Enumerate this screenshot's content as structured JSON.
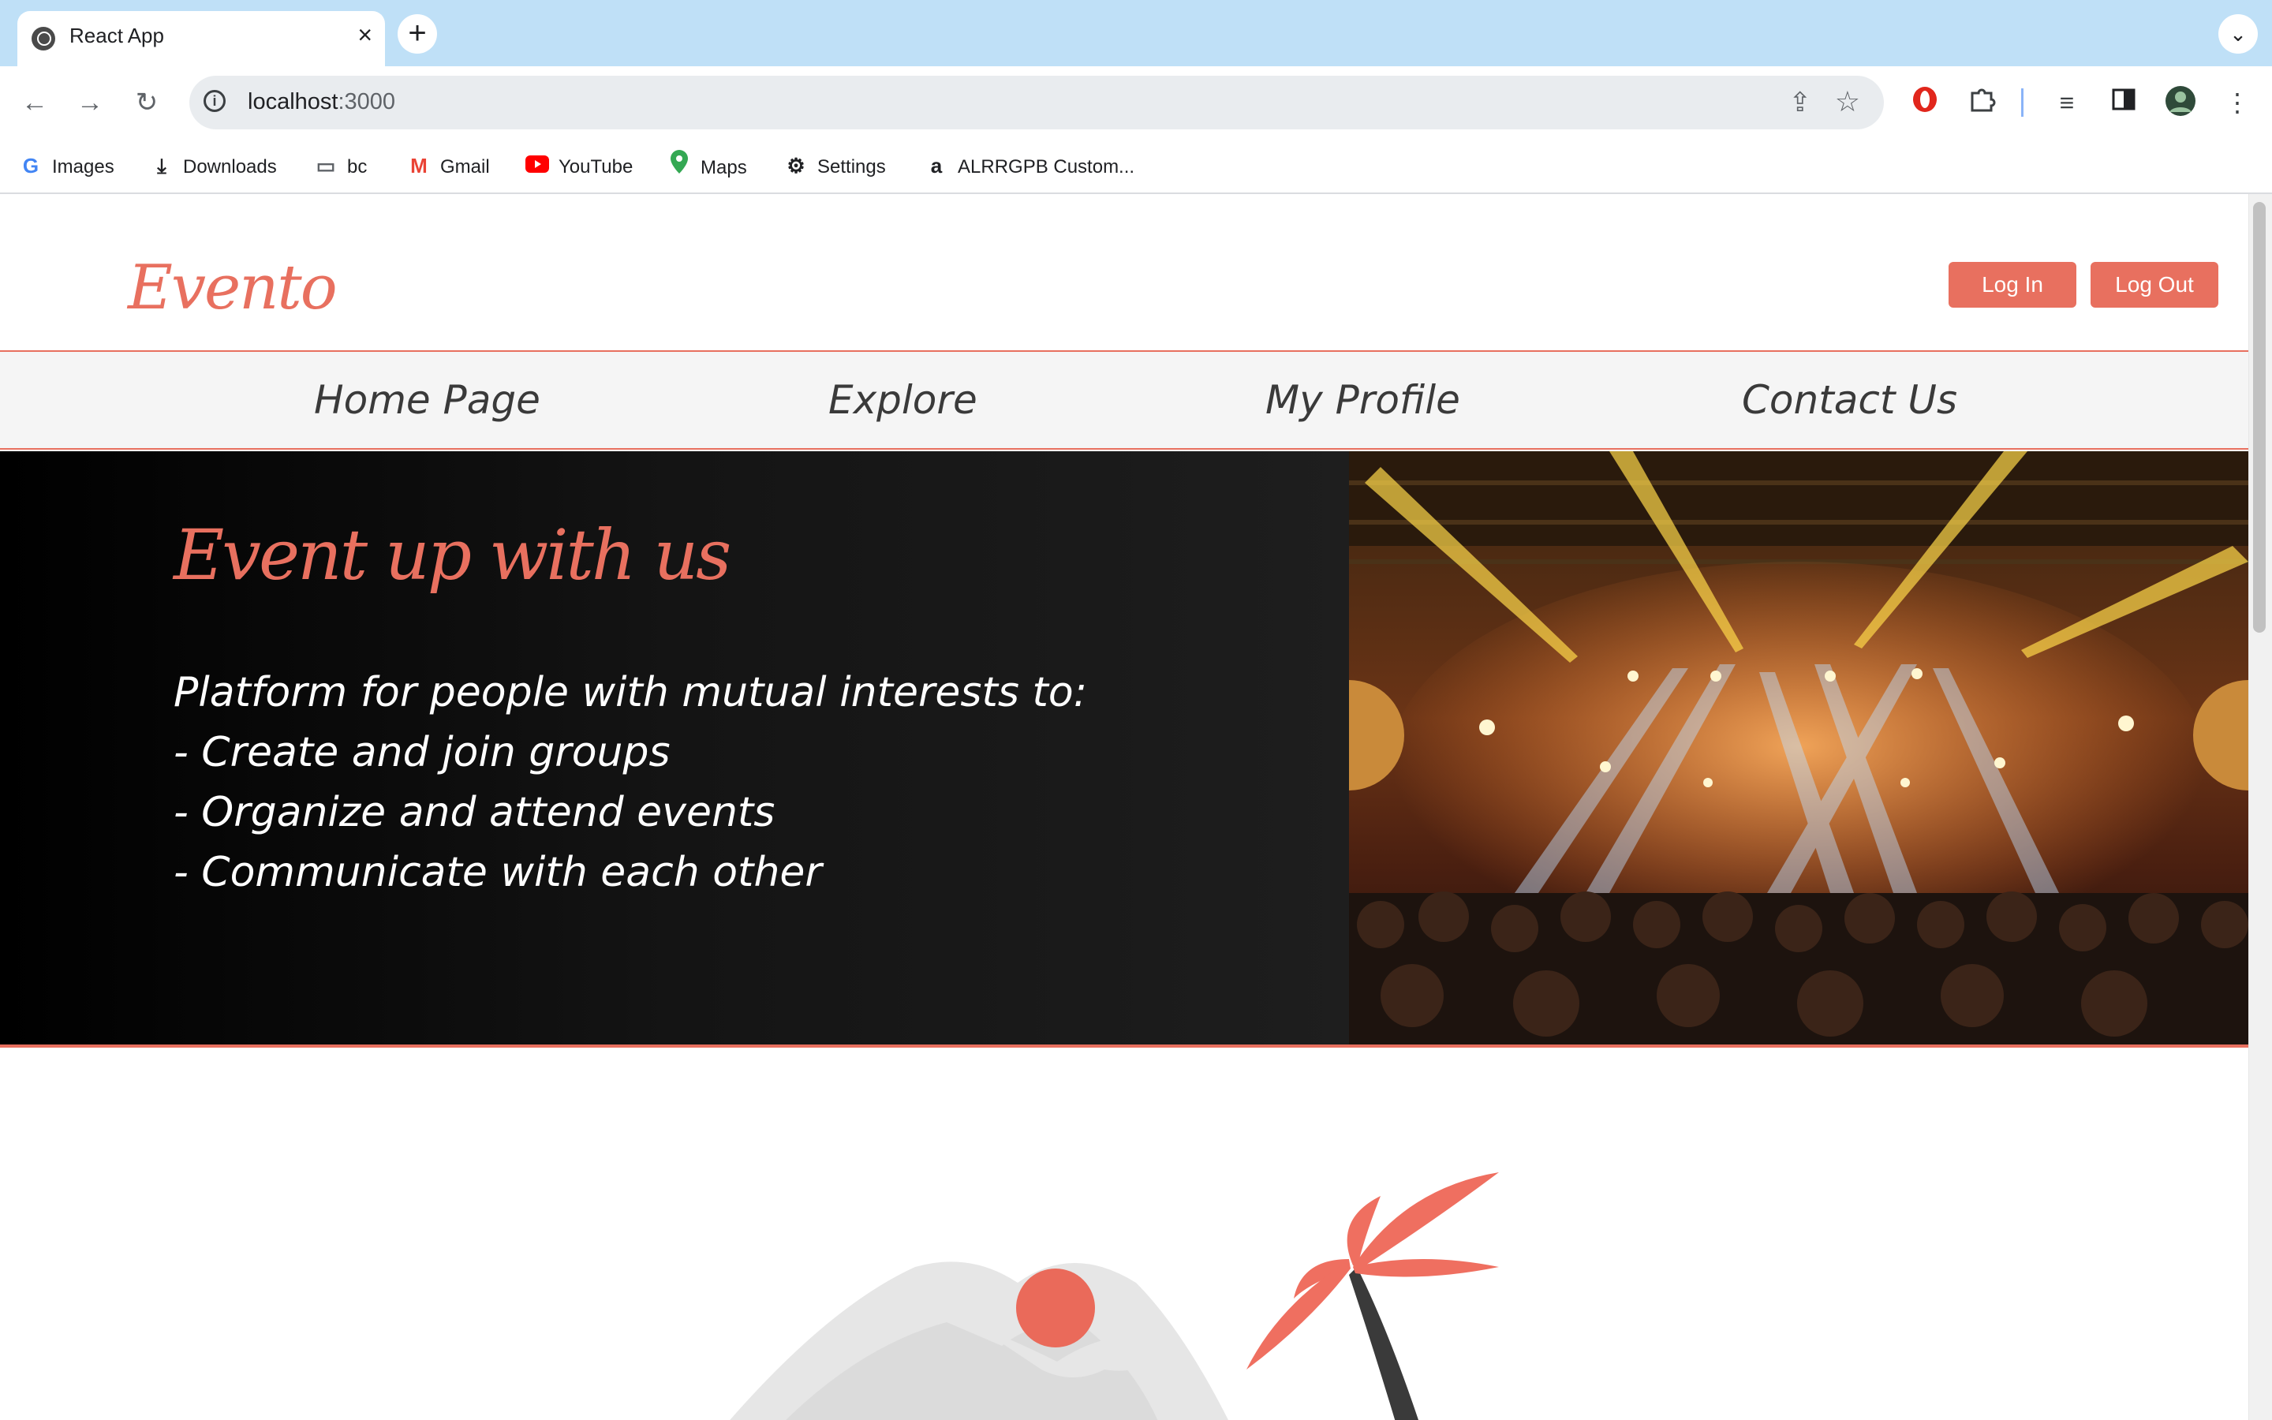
{
  "browser": {
    "tab_title": "React App",
    "url_host": "localhost",
    "url_port": ":3000",
    "bookmarks": [
      {
        "label": "Images",
        "icon": "google-icon"
      },
      {
        "label": "Downloads",
        "icon": "download-icon"
      },
      {
        "label": "bc",
        "icon": "folder-icon"
      },
      {
        "label": "Gmail",
        "icon": "gmail-icon"
      },
      {
        "label": "YouTube",
        "icon": "youtube-icon"
      },
      {
        "label": "Maps",
        "icon": "maps-icon"
      },
      {
        "label": "Settings",
        "icon": "gear-icon"
      },
      {
        "label": "ALRRGPB Custom...",
        "icon": "amazon-icon"
      }
    ]
  },
  "header": {
    "logo": "Evento",
    "login_label": "Log In",
    "logout_label": "Log Out"
  },
  "nav": {
    "items": [
      "Home Page",
      "Explore",
      "My Profile",
      "Contact Us"
    ]
  },
  "hero": {
    "title": "Event up with us",
    "lines": [
      "Platform for people with mutual interests to:",
      "- Create and join groups",
      "- Organize and attend events",
      "- Communicate with each other"
    ]
  },
  "colors": {
    "accent": "#e8705f",
    "tabstrip": "#bfe0f7",
    "nav_bg": "#f5f5f5",
    "hero_dark": "#1a1a1a"
  }
}
